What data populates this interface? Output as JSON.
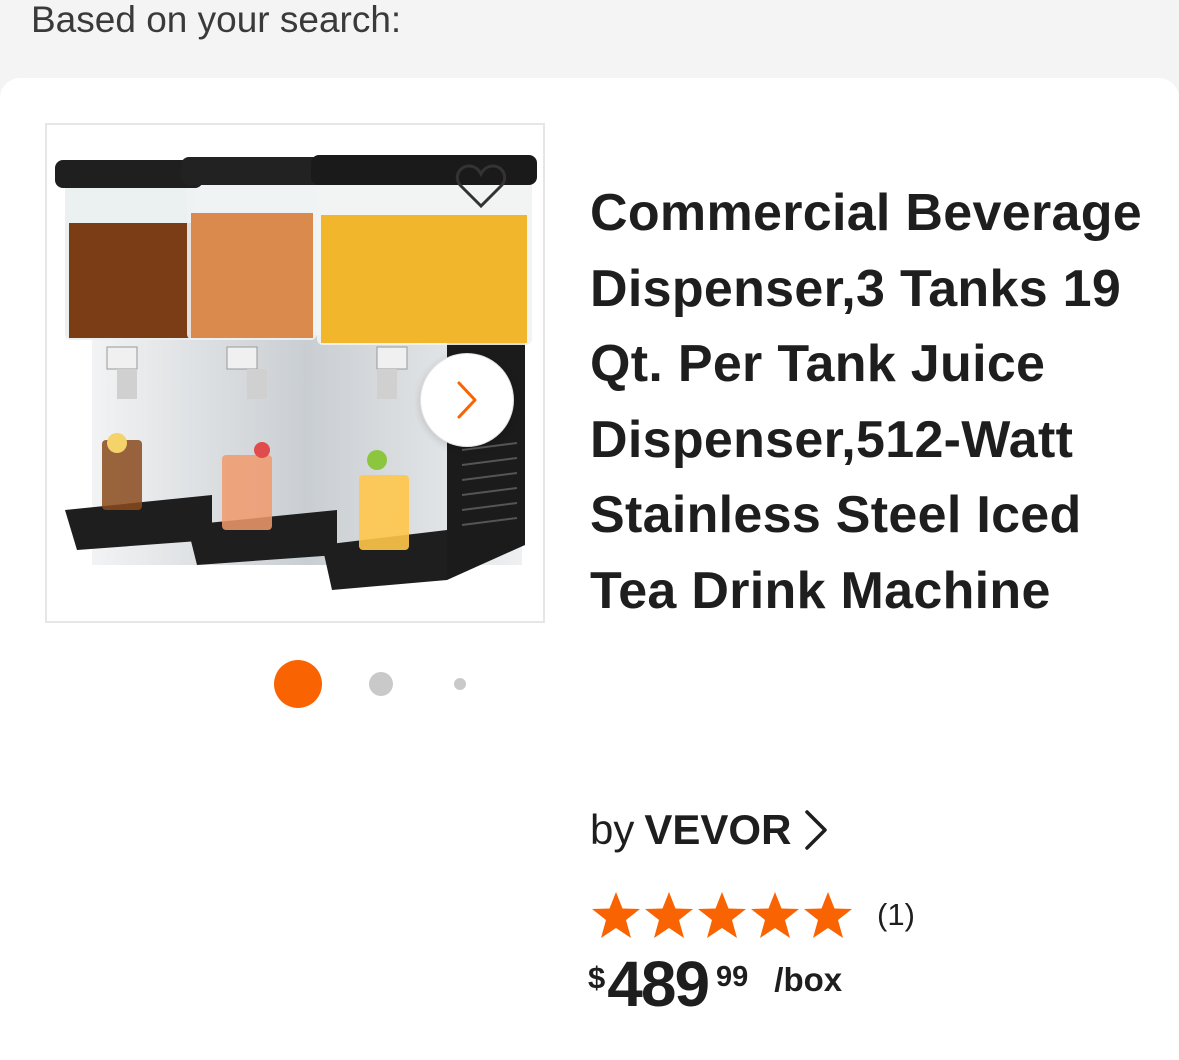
{
  "section": {
    "heading": "Based on your search:"
  },
  "product": {
    "title": "Commercial Beverage Dispenser,3 Tanks 19 Qt. Per Tank Juice Dispenser,512-Watt Stainless Steel Iced Tea Drink Machine",
    "brand_prefix": "by",
    "brand": "VEVOR",
    "rating_value": 5,
    "rating_max": 5,
    "review_count": "(1)",
    "price_currency": "$",
    "price_whole": "489",
    "price_cents": "99",
    "price_unit": "/box",
    "image_index": 1,
    "image_count": 3
  },
  "colors": {
    "accent": "#f96302",
    "dot_inactive": "#c9c9c9",
    "text": "#1e1e1e"
  },
  "icons": {
    "favorite": "heart-outline-icon",
    "next_image": "chevron-right-icon",
    "brand_link": "chevron-right-icon",
    "rating": "star-icon"
  }
}
